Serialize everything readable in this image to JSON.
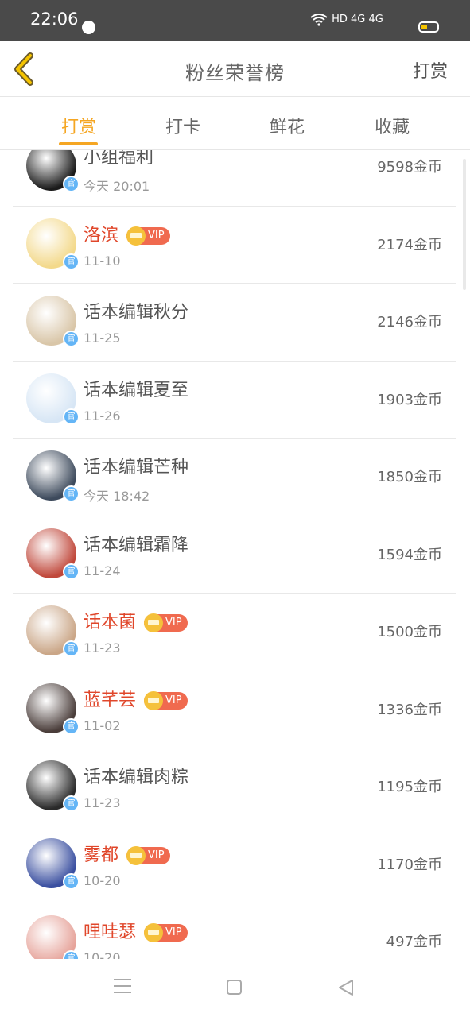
{
  "status_bar": {
    "time": "22:06",
    "system_icons": "HD 4G 4G",
    "battery_color": "#f5c400"
  },
  "header": {
    "back_icon": "chevron-left-icon",
    "title": "粉丝荣誉榜",
    "right_action": "打赏"
  },
  "tabs": [
    {
      "label": "打赏",
      "active": true
    },
    {
      "label": "打卡",
      "active": false
    },
    {
      "label": "鲜花",
      "active": false
    },
    {
      "label": "收藏",
      "active": false
    }
  ],
  "list": [
    {
      "name": "小组福利",
      "date": "今天 20:01",
      "amount": "9598金币",
      "vip": false,
      "avatar_color": "#1b1b1b"
    },
    {
      "name": "洛滨",
      "date": "11-10",
      "amount": "2174金币",
      "vip": true,
      "vip_label": "VIP",
      "avatar_color": "#f3d98b"
    },
    {
      "name": "话本编辑秋分",
      "date": "11-25",
      "amount": "2146金币",
      "vip": false,
      "avatar_color": "#d9c6a8"
    },
    {
      "name": "话本编辑夏至",
      "date": "11-26",
      "amount": "1903金币",
      "vip": false,
      "avatar_color": "#d7e6f5"
    },
    {
      "name": "话本编辑芒种",
      "date": "今天 18:42",
      "amount": "1850金币",
      "vip": false,
      "avatar_color": "#3d4a5c"
    },
    {
      "name": "话本编辑霜降",
      "date": "11-24",
      "amount": "1594金币",
      "vip": false,
      "avatar_color": "#c0473a"
    },
    {
      "name": "话本菌",
      "date": "11-23",
      "amount": "1500金币",
      "vip": true,
      "vip_label": "VIP",
      "avatar_color": "#caa687"
    },
    {
      "name": "蓝芊芸",
      "date": "11-02",
      "amount": "1336金币",
      "vip": true,
      "vip_label": "VIP",
      "avatar_color": "#4a3d3a"
    },
    {
      "name": "话本编辑肉粽",
      "date": "11-23",
      "amount": "1195金币",
      "vip": false,
      "avatar_color": "#2a2a2a"
    },
    {
      "name": "雾都",
      "date": "10-20",
      "amount": "1170金币",
      "vip": true,
      "vip_label": "VIP",
      "avatar_color": "#3a4fa0"
    },
    {
      "name": "哩哇瑟",
      "date": "10-20",
      "amount": "497金币",
      "vip": true,
      "vip_label": "VIP",
      "avatar_color": "#e6a39a"
    }
  ],
  "colors": {
    "accent": "#f5a623",
    "vip_name": "#e0472b",
    "vip_badge": "#f06a4f",
    "crown": "#f5c13b",
    "official_badge": "#64b5f6"
  }
}
